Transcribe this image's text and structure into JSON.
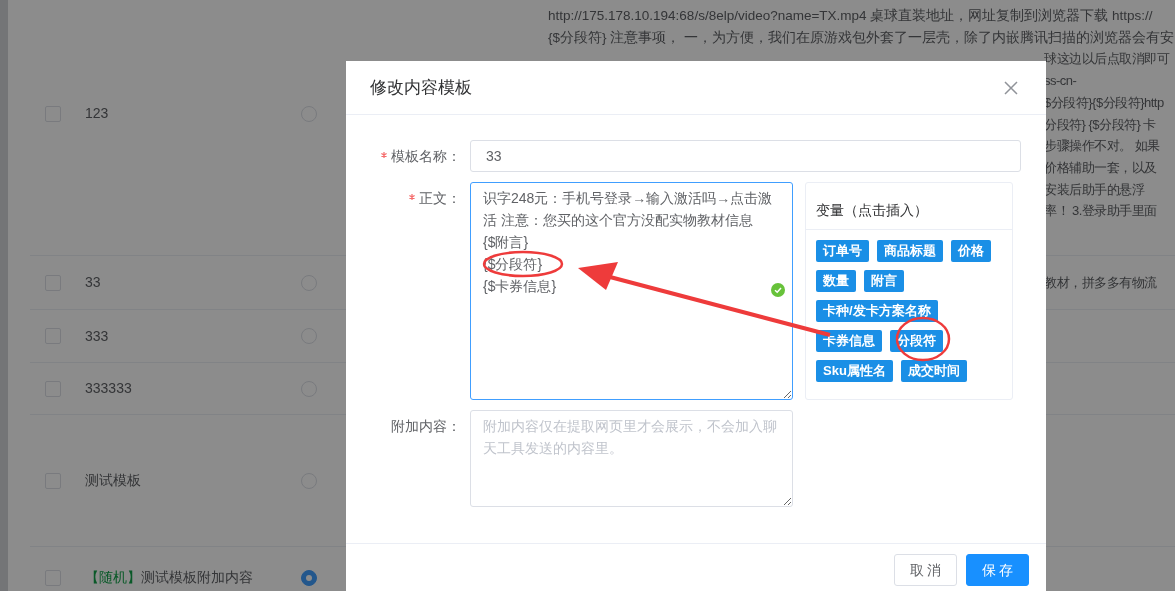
{
  "table": {
    "rows": [
      {
        "checked": false,
        "selected": false,
        "name": "123",
        "content_lines": [
          "http://175.178.10.194:68/s/8elp/video?name=TX.mp4 桌球直装地址，网址复制到浏览器下载 https://",
          "{$分段符} 注意事项， 一，为方便，我们在原游戏包外套了一层壳，除了内嵌腾讯扫描的浏览器会有安",
          "球这边以后点取消即可",
          "ss-cn-",
          "$分段符}{$分段符}http",
          "分段符} {$分段符} 卡",
          "步骤操作不对。 如果",
          "价格辅助一套，以及",
          "安装后助手的悬浮",
          "率！ 3.登录助手里面"
        ]
      },
      {
        "checked": false,
        "selected": false,
        "name": "33",
        "content_lines": [
          "教材，拼多多有物流"
        ]
      },
      {
        "checked": false,
        "selected": false,
        "name": "333"
      },
      {
        "checked": false,
        "selected": false,
        "name": "333333"
      },
      {
        "checked": false,
        "selected": false,
        "name": "测试模板"
      },
      {
        "checked": false,
        "selected": true,
        "tag": "【随机】",
        "name": "测试模板附加内容"
      }
    ]
  },
  "dialog": {
    "title": "修改内容模板",
    "fields": [
      {
        "kind": "input",
        "required": true,
        "label": "模板名称：",
        "value": "33"
      },
      {
        "kind": "textarea",
        "required": true,
        "focused": true,
        "valid": true,
        "label": "正文：",
        "value": "识字248元：手机号登录→输入激活吗→点击激活 注意：您买的这个官方没配实物教材信息\n{$附言}\n{$分段符}\n{$卡券信息}"
      },
      {
        "kind": "textarea",
        "required": false,
        "focused": false,
        "label": "附加内容：",
        "placeholder": "附加内容仅在提取网页里才会展示，不会加入聊天工具发送的内容里。"
      }
    ],
    "variables": {
      "title": "变量（点击插入）",
      "tags": [
        "订单号",
        "商品标题",
        "价格",
        "数量",
        "附言",
        "卡种/发卡方案名称",
        "卡券信息",
        "分段符",
        "Sku属性名",
        "成交时间"
      ]
    },
    "buttons": [
      {
        "kind": "default",
        "label": "取 消"
      },
      {
        "kind": "primary",
        "label": "保 存"
      }
    ]
  }
}
